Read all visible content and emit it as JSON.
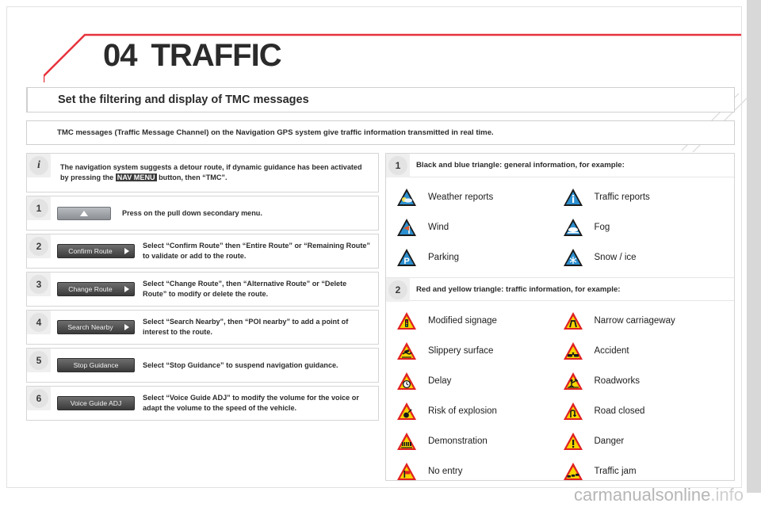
{
  "chapter": {
    "number": "04",
    "title": "TRAFFIC"
  },
  "section": {
    "heading": "Set the filtering and display of TMC messages",
    "intro": "TMC messages (Traffic Message Channel) on the Navigation GPS system give traffic information transmitted in real time."
  },
  "info_note": {
    "badge": "i",
    "text_before": "The navigation system suggests a detour route, if dynamic guidance has been activated by pressing the ",
    "highlight": "NAV MENU",
    "text_after": " button, then “TMC”."
  },
  "steps": [
    {
      "badge": "1",
      "control": "",
      "control_type": "updown",
      "text": "Press on the pull down secondary menu."
    },
    {
      "badge": "2",
      "control": "Confirm Route",
      "control_type": "menu",
      "text": "Select “Confirm Route” then “Entire Route” or “Remaining Route” to validate or add to the route."
    },
    {
      "badge": "3",
      "control": "Change Route",
      "control_type": "menu",
      "text": "Select “Change Route”, then “Alternative Route” or “Delete Route” to modify or delete the route."
    },
    {
      "badge": "4",
      "control": "Search Nearby",
      "control_type": "menu",
      "text": "Select “Search Nearby”, then “POI nearby” to add a point of interest to the route."
    },
    {
      "badge": "5",
      "control": "Stop Guidance",
      "control_type": "menu-plain",
      "text": "Select “Stop Guidance” to suspend navigation guidance."
    },
    {
      "badge": "6",
      "control": "Voice Guide ADJ",
      "control_type": "menu-plain",
      "text": "Select “Voice Guide ADJ” to modify the volume for the voice or adapt the volume to the speed of the vehicle."
    }
  ],
  "legend_sections": [
    {
      "badge": "1",
      "heading": "Black and blue triangle: general information, for example:",
      "style": "blue",
      "items": [
        {
          "label": "Weather reports",
          "icon": "weather-triangle-icon",
          "glyph": "⛅"
        },
        {
          "label": "Traffic reports",
          "icon": "info-triangle-icon",
          "glyph": "i"
        },
        {
          "label": "Wind",
          "icon": "wind-triangle-icon",
          "glyph": "⤳"
        },
        {
          "label": "Fog",
          "icon": "fog-triangle-icon",
          "glyph": "☁"
        },
        {
          "label": "Parking",
          "icon": "parking-triangle-icon",
          "glyph": "P"
        },
        {
          "label": "Snow / ice",
          "icon": "snow-triangle-icon",
          "glyph": "❄"
        }
      ]
    },
    {
      "badge": "2",
      "heading": "Red and yellow triangle: traffic information, for example:",
      "style": "red",
      "items": [
        {
          "label": "Modified signage",
          "icon": "traffic-light-triangle-icon",
          "glyph": "▯"
        },
        {
          "label": "Narrow carriageway",
          "icon": "narrow-road-triangle-icon",
          "glyph": "∩"
        },
        {
          "label": "Slippery surface",
          "icon": "slippery-triangle-icon",
          "glyph": "≋"
        },
        {
          "label": "Accident",
          "icon": "accident-triangle-icon",
          "glyph": "⤧"
        },
        {
          "label": "Delay",
          "icon": "delay-clock-triangle-icon",
          "glyph": "○"
        },
        {
          "label": "Roadworks",
          "icon": "roadworks-triangle-icon",
          "glyph": "⛏"
        },
        {
          "label": "Risk of explosion",
          "icon": "explosion-triangle-icon",
          "glyph": "⬤"
        },
        {
          "label": "Road closed",
          "icon": "road-closed-triangle-icon",
          "glyph": "↰"
        },
        {
          "label": "Demonstration",
          "icon": "demonstration-triangle-icon",
          "glyph": "▤"
        },
        {
          "label": "Danger",
          "icon": "exclamation-triangle-icon",
          "glyph": "!"
        },
        {
          "label": "No entry",
          "icon": "no-entry-triangle-icon",
          "glyph": "⚑"
        },
        {
          "label": "Traffic jam",
          "icon": "traffic-jam-triangle-icon",
          "glyph": "≋"
        }
      ]
    }
  ],
  "watermark": {
    "text_main": "carmanualsonline",
    "text_suffix": ".info"
  },
  "colors": {
    "accent_red": "#e8323c",
    "blue_sign": "#2b8fd0",
    "yellow_sign": "#f5d400",
    "red_sign": "#e02020",
    "text": "#2b2b2b"
  }
}
